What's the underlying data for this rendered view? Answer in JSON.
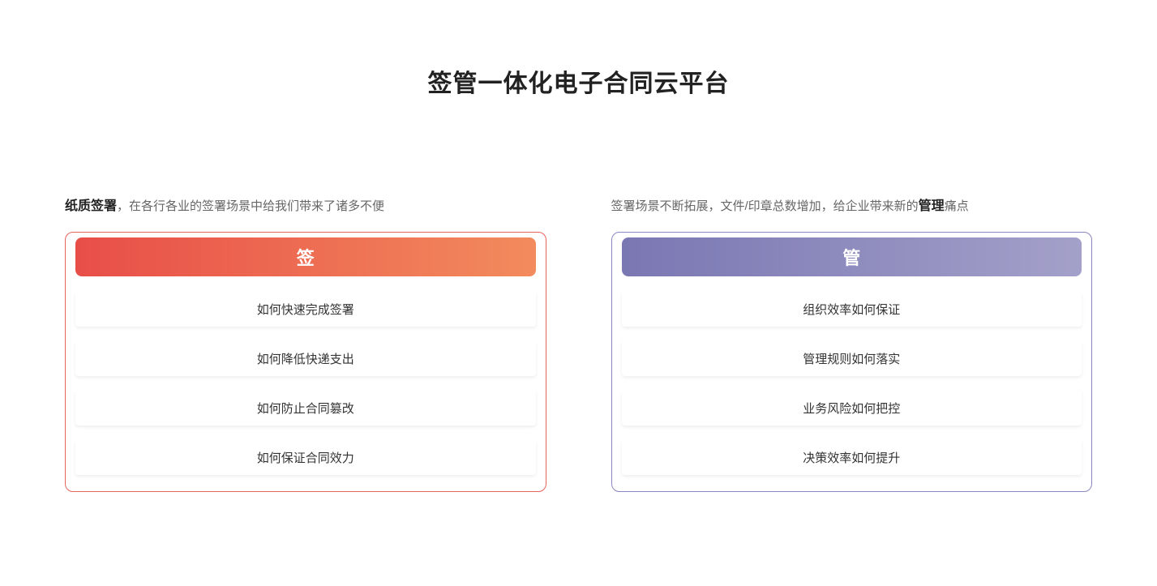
{
  "title": "签管一体化电子合同云平台",
  "sign": {
    "lead_bold": "纸质签署",
    "lead_rest": "，在各行各业的签署场景中给我们带来了诸多不便",
    "header": "签",
    "items": [
      "如何快速完成签署",
      "如何降低快递支出",
      "如何防止合同篡改",
      "如何保证合同效力"
    ]
  },
  "manage": {
    "lead_before": "签署场景不断拓展，文件/印章总数增加，给企业带来新的",
    "lead_bold": "管理",
    "lead_after": "痛点",
    "header": "管",
    "items": [
      "组织效率如何保证",
      "管理规则如何落实",
      "业务风险如何把控",
      "决策效率如何提升"
    ]
  }
}
